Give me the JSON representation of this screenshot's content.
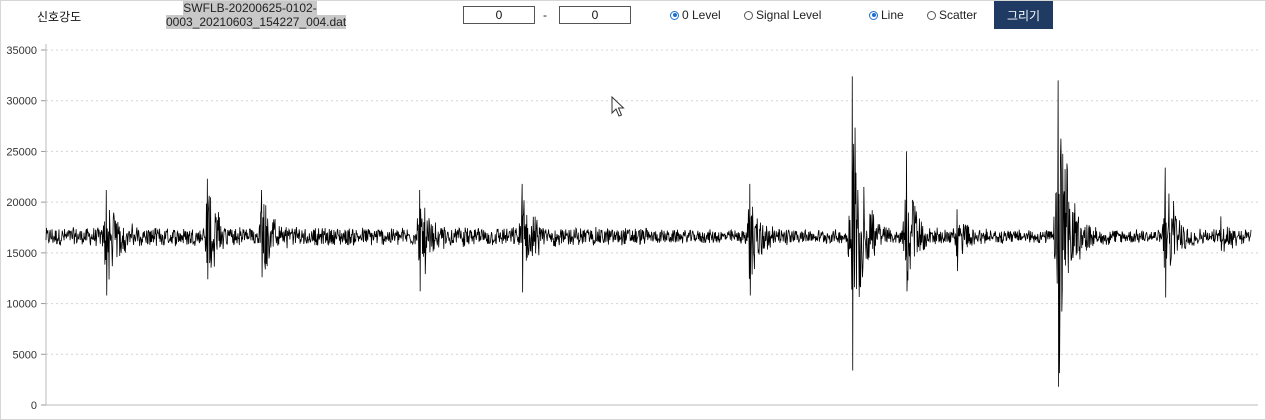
{
  "toolbar": {
    "signal_label": "신호강도",
    "filename_line1": "SWFLB-20200625-0102-",
    "filename_line2": "0003_20210603_154227_004.dat",
    "range_from": "0",
    "range_sep": "-",
    "range_to": "0",
    "radio_level": {
      "zero_level": "0 Level",
      "signal_level": "Signal Level",
      "selected": "0 Level"
    },
    "radio_plot": {
      "line": "Line",
      "scatter": "Scatter",
      "selected": "Line"
    },
    "draw_button": "그리기"
  },
  "colors": {
    "button_bg": "#1f3b64",
    "series": "#000000",
    "grid": "#d4d4d4",
    "radio_selected": "#1b6fd1"
  },
  "chart_data": {
    "type": "line",
    "title": "",
    "xlabel": "",
    "ylabel": "",
    "ylim": [
      0,
      35000
    ],
    "yticks": [
      0,
      5000,
      10000,
      15000,
      20000,
      25000,
      30000,
      35000
    ],
    "grid": "horizontal dotted",
    "legend": "none",
    "baseline": 16600,
    "noise_amplitude": 1000,
    "x_range": [
      0,
      1
    ],
    "bursts": [
      {
        "x": 0.05,
        "peak_high": 21200,
        "peak_low": 10800
      },
      {
        "x": 0.134,
        "peak_high": 22300,
        "peak_low": 12400
      },
      {
        "x": 0.179,
        "peak_high": 21200,
        "peak_low": 12600
      },
      {
        "x": 0.31,
        "peak_high": 21200,
        "peak_low": 11200
      },
      {
        "x": 0.395,
        "peak_high": 21800,
        "peak_low": 11100
      },
      {
        "x": 0.584,
        "peak_high": 21800,
        "peak_low": 10800
      },
      {
        "x": 0.674,
        "peak_high": 18700,
        "peak_low": 15000
      },
      {
        "x": 0.669,
        "peak_high": 32400,
        "peak_low": 3400
      },
      {
        "x": 0.714,
        "peak_high": 25000,
        "peak_low": 11200
      },
      {
        "x": 0.756,
        "peak_high": 19300,
        "peak_low": 13200
      },
      {
        "x": 0.84,
        "peak_high": 32000,
        "peak_low": 1800
      },
      {
        "x": 0.929,
        "peak_high": 23400,
        "peak_low": 10600
      },
      {
        "x": 0.975,
        "peak_high": 18600,
        "peak_low": 15200
      }
    ]
  }
}
